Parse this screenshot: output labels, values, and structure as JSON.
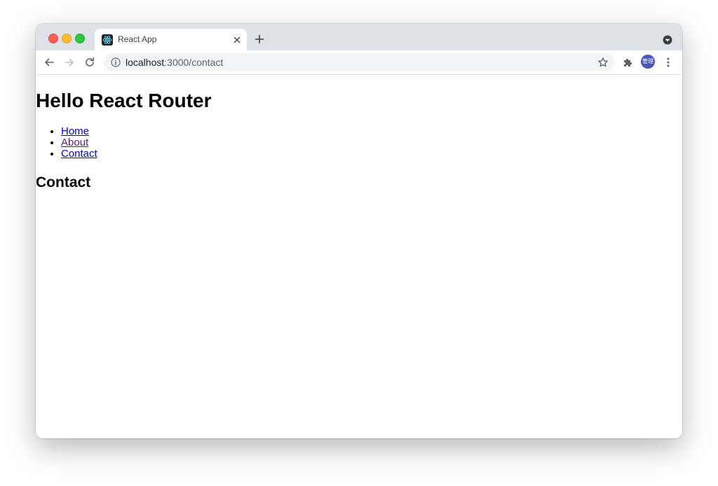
{
  "browser": {
    "tab_title": "React App",
    "url_host": "localhost",
    "url_path": ":3000/contact",
    "avatar_text": "管理",
    "icons": [
      "react-favicon-icon",
      "close-icon",
      "plus-icon",
      "tab-search-icon",
      "back-arrow-icon",
      "forward-arrow-icon",
      "reload-icon",
      "info-icon",
      "star-icon",
      "puzzle-icon",
      "kebab-menu-icon"
    ]
  },
  "page": {
    "heading": "Hello React Router",
    "nav": [
      {
        "label": "Home"
      },
      {
        "label": "About"
      },
      {
        "label": "Contact"
      }
    ],
    "subheading": "Contact"
  },
  "colors": {
    "link": "#0000ee",
    "visited_link": "#551a8b",
    "titlebar": "#dee1e6",
    "avatar": "#4b55c0"
  }
}
